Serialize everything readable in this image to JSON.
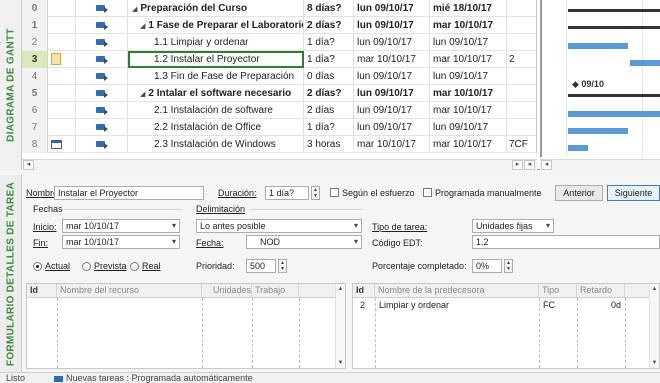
{
  "gantt": {
    "side_label": "DIAGRAMA DE GANTT",
    "rows": [
      {
        "id": "0",
        "name": "Preparación del Curso",
        "outline": "summary-top",
        "duration": "8 días?",
        "start": "lun 09/10/17",
        "end": "mié 18/10/17",
        "pred": ""
      },
      {
        "id": "1",
        "name": "1 Fase de Preparar el Laboratorio",
        "outline": "summary",
        "duration": "2 días?",
        "start": "lun 09/10/17",
        "end": "mar 10/10/17",
        "pred": ""
      },
      {
        "id": "2",
        "name": "1.1 Limpiar y ordenar",
        "outline": "task",
        "duration": "1 día?",
        "start": "lun 09/10/17",
        "end": "lun 09/10/17",
        "pred": ""
      },
      {
        "id": "3",
        "name": "1.2 Instalar el Proyector",
        "outline": "task",
        "duration": "1 día?",
        "start": "mar 10/10/17",
        "end": "mar 10/10/17",
        "pred": "2"
      },
      {
        "id": "4",
        "name": "1.3 Fin de Fase de Preparación",
        "outline": "task",
        "duration": "0 días",
        "start": "lun 09/10/17",
        "end": "lun 09/10/17",
        "pred": ""
      },
      {
        "id": "5",
        "name": "2 Intalar el software necesario",
        "outline": "summary",
        "duration": "2 días?",
        "start": "lun 09/10/17",
        "end": "mar 10/10/17",
        "pred": ""
      },
      {
        "id": "6",
        "name": "2.1 Instalación de software",
        "outline": "task",
        "duration": "2 días",
        "start": "lun 09/10/17",
        "end": "mar 10/10/17",
        "pred": ""
      },
      {
        "id": "7",
        "name": "2.2 Instalación de Office",
        "outline": "task",
        "duration": "1 día?",
        "start": "lun 09/10/17",
        "end": "lun 09/10/17",
        "pred": ""
      },
      {
        "id": "8",
        "name": "2.3 Instalación de Windows",
        "outline": "task",
        "duration": "3 horas",
        "start": "mar 10/10/17",
        "end": "mar 10/10/17",
        "pred": "7CF"
      }
    ],
    "milestone_label": "09/10",
    "scroll_left": "◂",
    "scroll_right": "▸"
  },
  "form": {
    "side_label": "FORMULARIO DETALLES DE TAREA",
    "name_label": "Nombre:",
    "name_value": "Instalar el Proyector",
    "duration_label": "Duración:",
    "duration_value": "1 día?",
    "effort_label": "Según el esfuerzo",
    "manual_label": "Programada manualmente",
    "prev_button": "Anterior",
    "next_button": "Siguiente",
    "dates_group": "Fechas",
    "start_label": "Inicio:",
    "start_value": "mar 10/10/17",
    "end_label": "Fin:",
    "end_value": "mar 10/10/17",
    "radio_actual": "Actual",
    "radio_prevista": "Prevista",
    "radio_real": "Real",
    "delim_group": "Delimitación",
    "constraint_value": "Lo antes posible",
    "fecha_label": "Fecha:",
    "fecha_value": "NOD",
    "priority_label": "Prioridad:",
    "priority_value": "500",
    "task_type_label": "Tipo de tarea:",
    "task_type_value": "Unidades fijas",
    "wbs_label": "Código EDT:",
    "wbs_value": "1.2",
    "percent_label": "Porcentaje completado:",
    "percent_value": "0%",
    "resources_table": {
      "columns": [
        "Id",
        "Nombre del recurso",
        "Unidades",
        "Trabajo"
      ]
    },
    "pred_table": {
      "columns": [
        "Id",
        "Nombre de la predecesora",
        "Tipo",
        "Retardo"
      ],
      "rows": [
        {
          "id": "2",
          "name": "Limpiar y ordenar",
          "type": "FC",
          "lag": "0d"
        }
      ]
    }
  },
  "status": {
    "ready": "Listo",
    "mode_text": "Nuevas tareas : Programada automáticamente"
  },
  "colors": {
    "accent_green": "#3d8b3d",
    "gantt_bar": "#5b9bd5",
    "task_mode_icon": "#2f6db5"
  }
}
